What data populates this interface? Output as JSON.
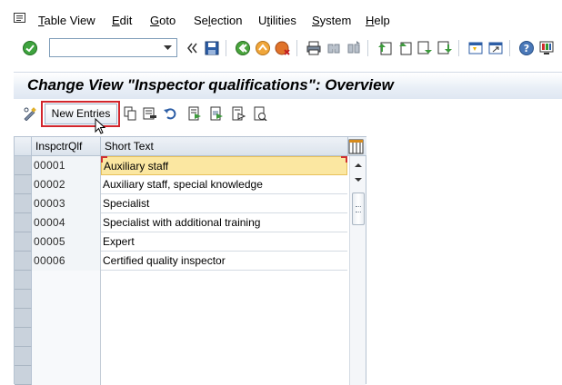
{
  "menu": {
    "items": [
      {
        "label_ul": "T",
        "label_rest": "able View"
      },
      {
        "label_ul": "E",
        "label_rest": "dit"
      },
      {
        "label_ul": "G",
        "label_rest": "oto"
      },
      {
        "label_pre": "Se",
        "label_ul": "l",
        "label_rest": "ection"
      },
      {
        "label_pre": "U",
        "label_ul": "t",
        "label_rest": "ilities"
      },
      {
        "label_ul": "S",
        "label_rest": "ystem"
      },
      {
        "label_ul": "H",
        "label_rest": "elp"
      }
    ]
  },
  "toolbar": {
    "command_value": "",
    "icons": [
      "enter-icon",
      "command-dropdown-icon",
      "back-chevron-icon",
      "save-icon",
      "back-icon",
      "exit-icon",
      "cancel-icon",
      "print-icon",
      "find-icon",
      "find-next-icon",
      "first-page-icon",
      "previous-page-icon",
      "next-page-icon",
      "last-page-icon",
      "create-session-icon",
      "shortcut-icon",
      "help-icon",
      "customize-layout-icon"
    ]
  },
  "page": {
    "title": "Change View \"Inspector qualifications\": Overview"
  },
  "app_toolbar": {
    "new_entries_label": "New Entries",
    "icons": [
      "display-change-icon",
      "copy-as-icon",
      "delete-icon",
      "undo-change-icon",
      "select-all-icon",
      "select-block-icon",
      "deselect-all-icon",
      "other-entry-icon"
    ]
  },
  "table": {
    "columns": [
      "InspctrQlf",
      "Short Text"
    ],
    "rows": [
      {
        "key": "00001",
        "text": "Auxiliary staff"
      },
      {
        "key": "00002",
        "text": "Auxiliary staff, special knowledge"
      },
      {
        "key": "00003",
        "text": "Specialist"
      },
      {
        "key": "00004",
        "text": "Specialist with additional training"
      },
      {
        "key": "00005",
        "text": "Expert"
      },
      {
        "key": "00006",
        "text": "Certified quality inspector"
      }
    ],
    "active_row": 0
  },
  "colors": {
    "highlight_border": "#d2252c",
    "active_cell": "#fbe7a1"
  }
}
